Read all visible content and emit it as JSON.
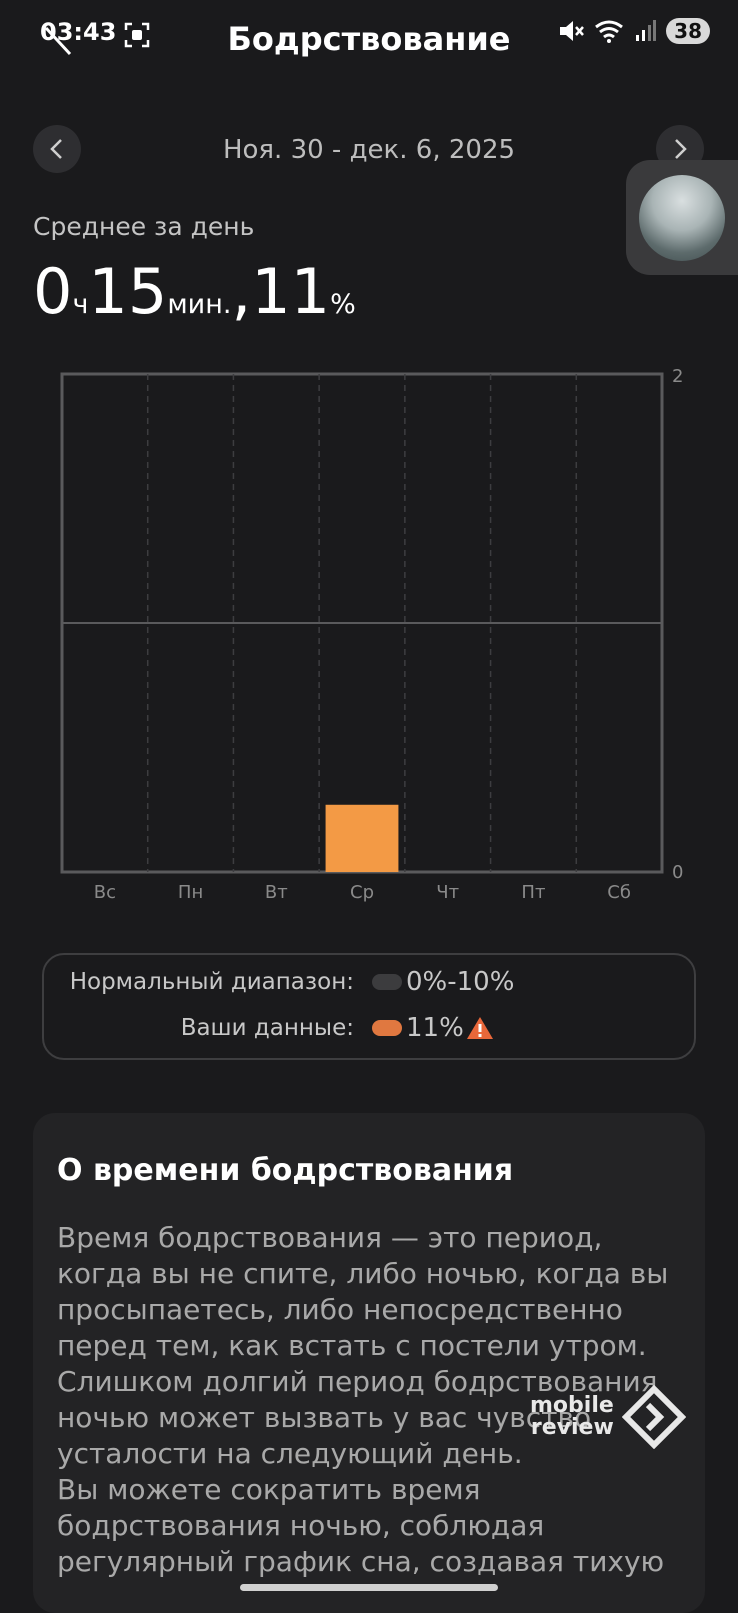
{
  "status_bar": {
    "time": "03:43",
    "battery": "38",
    "icons": [
      "screenshot-icon",
      "mute-icon",
      "wifi-icon",
      "signal-icon"
    ]
  },
  "header": {
    "title": "Бодрствование"
  },
  "date_nav": {
    "range": "Ноя. 30 - дек. 6, 2025"
  },
  "summary": {
    "label": "Среднее за день",
    "hours": "0",
    "hours_unit": "ч",
    "minutes": "15",
    "minutes_unit": "мин.",
    "separator": ",",
    "percent": "11",
    "percent_unit": "%"
  },
  "chart_data": {
    "type": "bar",
    "categories": [
      "Вс",
      "Пн",
      "Вт",
      "Ср",
      "Чт",
      "Пт",
      "Сб"
    ],
    "values": [
      0,
      0,
      0,
      0.27,
      0,
      0,
      0
    ],
    "ylim": [
      0,
      2
    ],
    "y_ticks": [
      "2",
      "0"
    ],
    "grid": true,
    "bar_color": "#f39a45"
  },
  "legend": {
    "normal_label": "Нормальный диапазон:",
    "normal_value": "0%-10%",
    "normal_color": "#3c3c3e",
    "yours_label": "Ваши данные:",
    "yours_value": "11%",
    "yours_color": "#e07840",
    "warning_icon": "warning-icon"
  },
  "info_card": {
    "title": "О времени бодрствования",
    "text": "Время бодрствования — это период,\nкогда вы не спите, либо ночью, когда вы\nпросыпаетесь, либо непосредственно\nперед тем, как встать с постели утром.\nСлишком долгий период бодрствования\nночью может вызвать у вас чувство\nусталости на следующий день.\nВы можете сократить время\nбодрствования ночью, соблюдая\nрегулярный график сна, создавая тихую"
  },
  "watermark": {
    "line1": "mobile",
    "line2": "review"
  }
}
